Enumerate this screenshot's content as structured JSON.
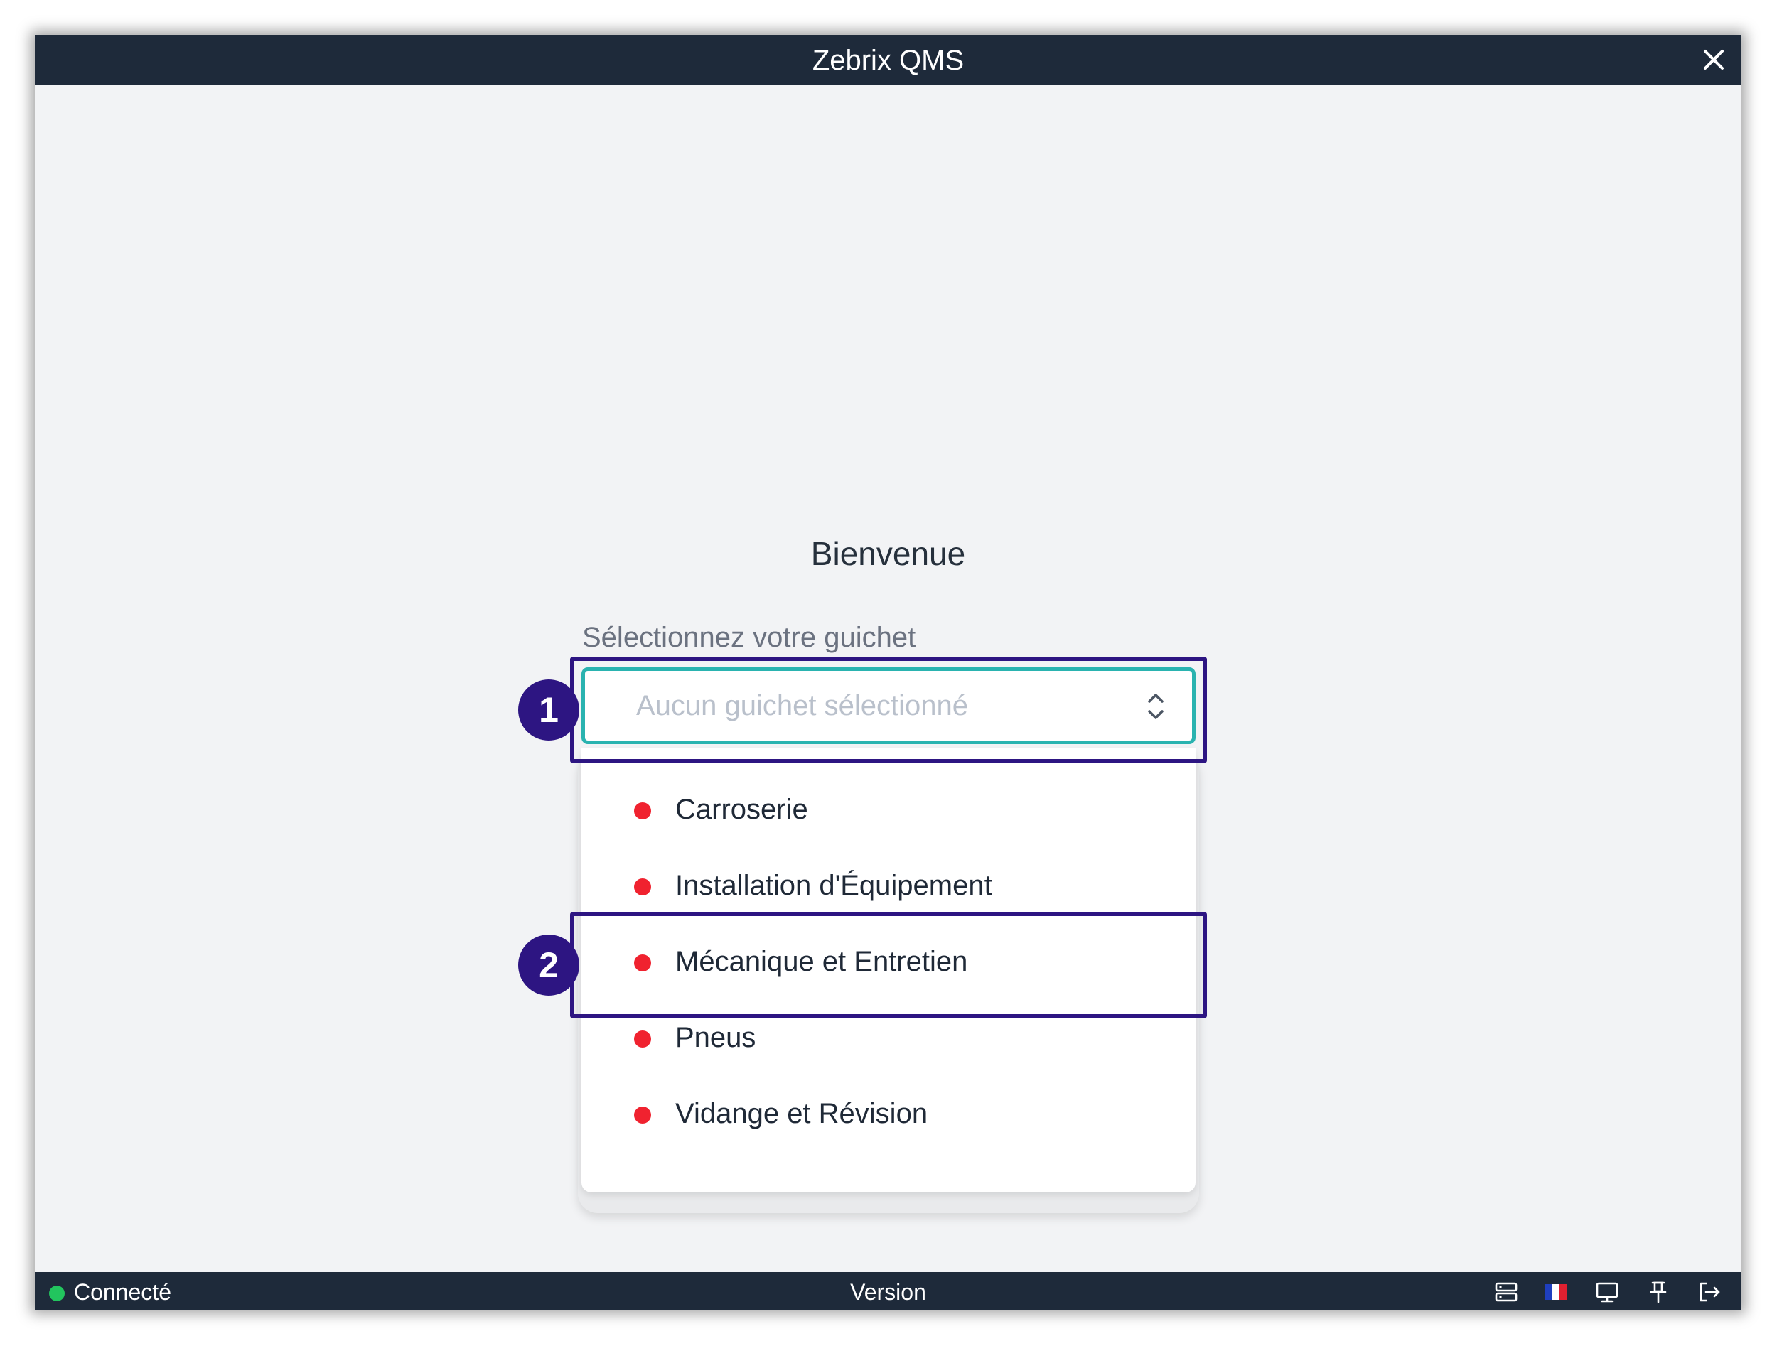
{
  "window": {
    "title": "Zebrix QMS"
  },
  "main": {
    "welcome": "Bienvenue",
    "select_label": "Sélectionnez votre guichet",
    "select_placeholder": "Aucun guichet sélectionné",
    "options": [
      {
        "label": "Carroserie",
        "status_color": "#f0222f"
      },
      {
        "label": "Installation d'Équipement",
        "status_color": "#f0222f"
      },
      {
        "label": "Mécanique et Entretien",
        "status_color": "#f0222f"
      },
      {
        "label": "Pneus",
        "status_color": "#f0222f"
      },
      {
        "label": "Vidange et Révision",
        "status_color": "#f0222f"
      }
    ]
  },
  "annotations": {
    "step1": "1",
    "step2": "2"
  },
  "statusbar": {
    "connection": "Connecté",
    "connection_color": "#22c55e",
    "version": "Version",
    "icons": [
      "server-icon",
      "french-flag-icon",
      "display-icon",
      "pin-icon",
      "logout-icon"
    ]
  },
  "colors": {
    "titlebar": "#1e2a3a",
    "accent": "#2ab3b0",
    "annotation": "#2d1582"
  }
}
